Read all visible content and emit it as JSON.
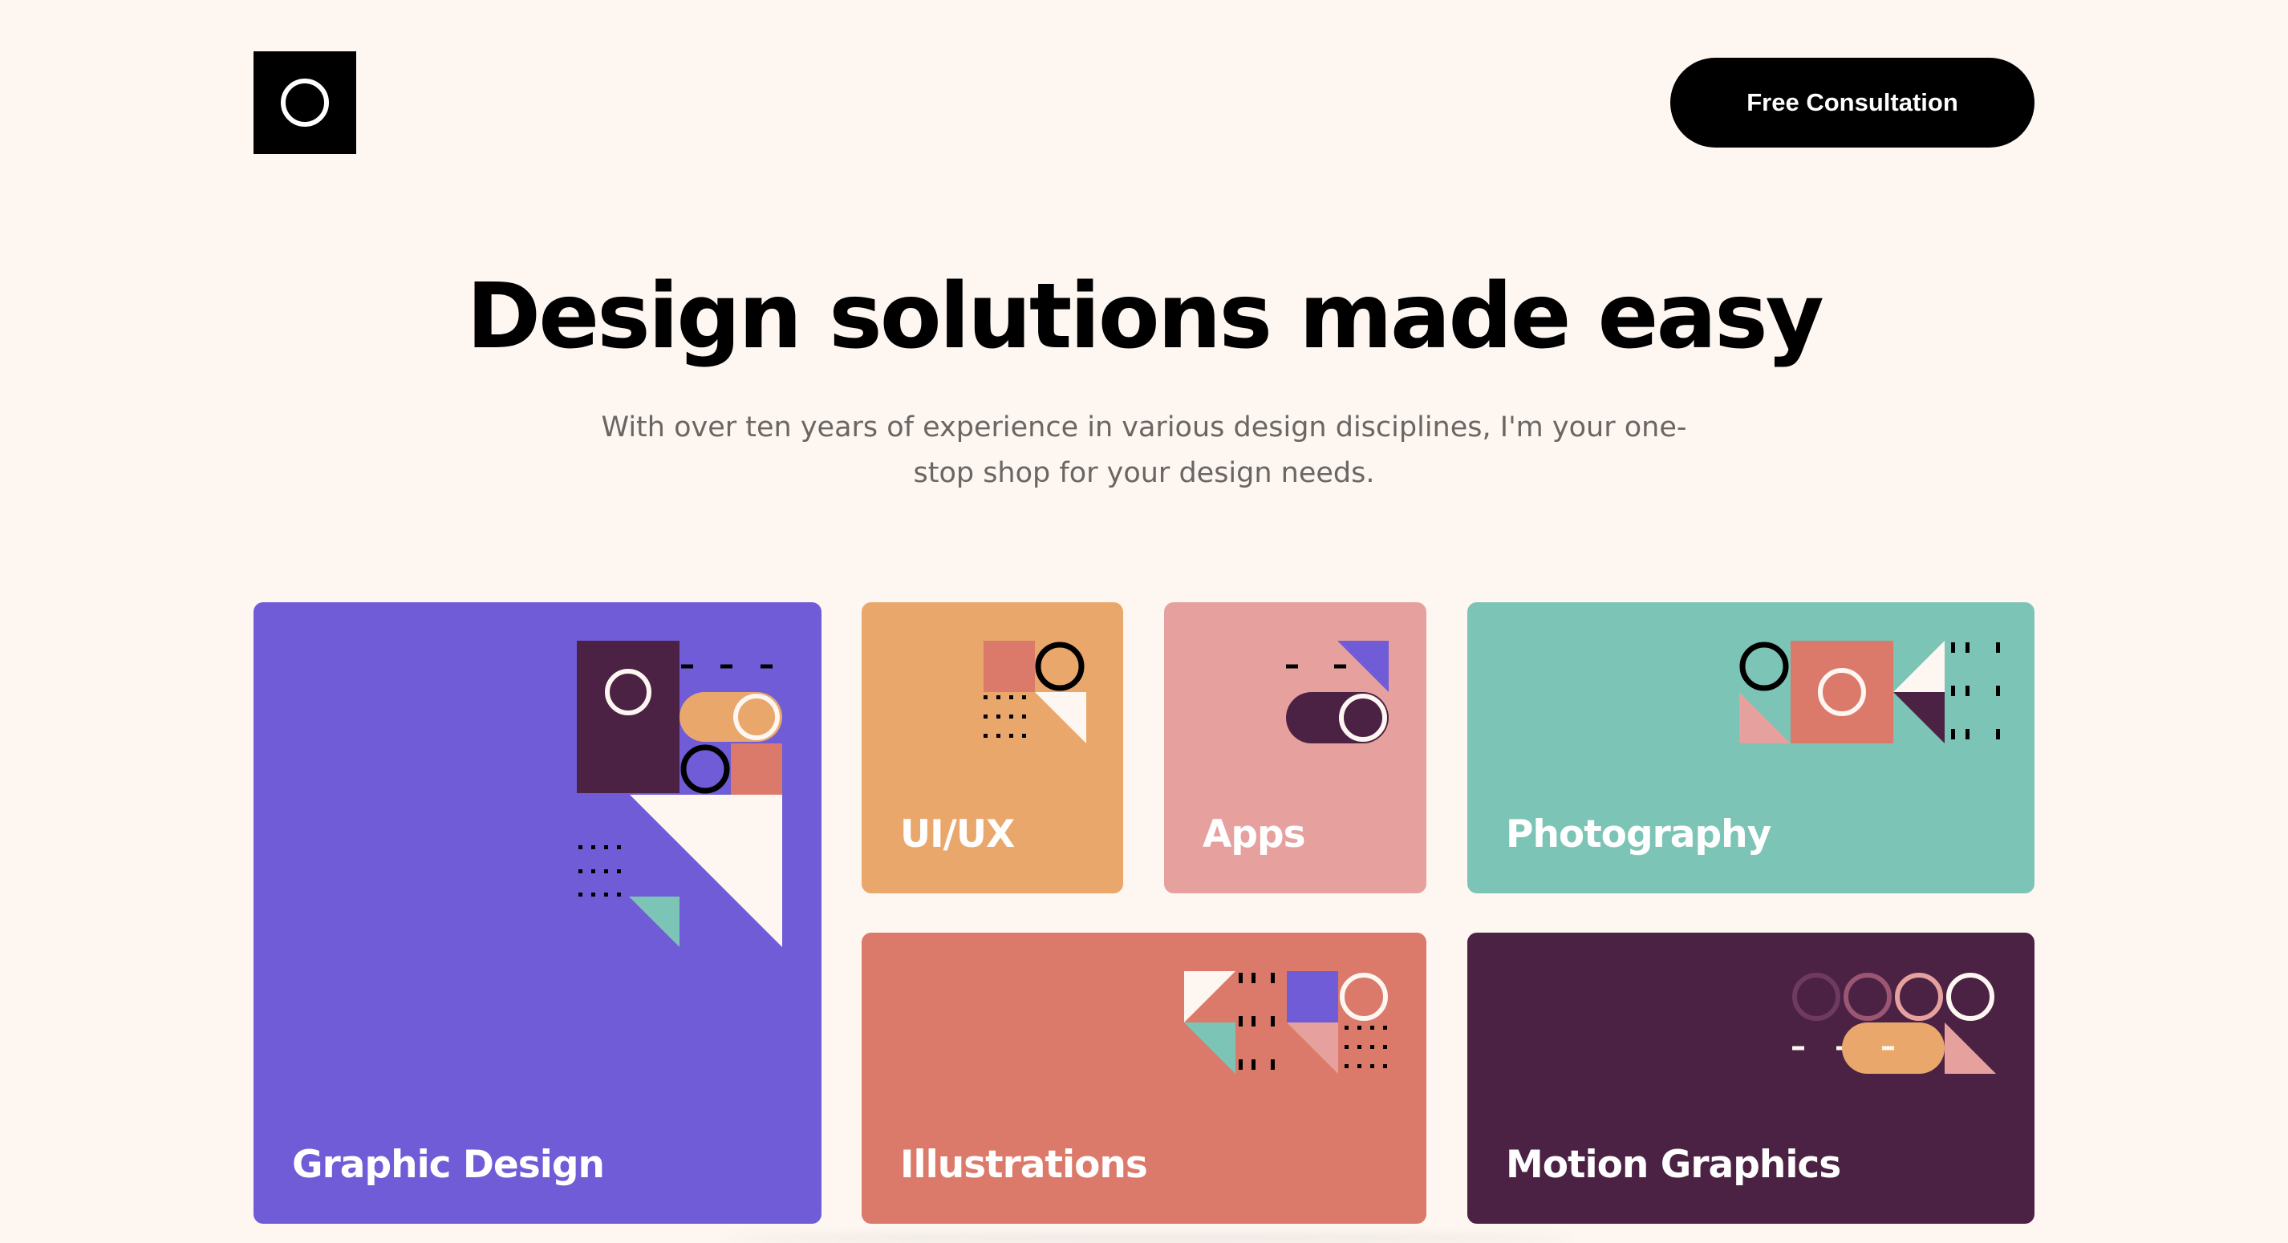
{
  "header": {
    "logo_icon": "circle-ring-logo",
    "cta_label": "Free Consultation"
  },
  "hero": {
    "title": "Design solutions made easy",
    "subtitle": "With over ten years of experience in various design disciplines, I'm your one-stop shop for your design needs."
  },
  "services": [
    {
      "label": "Graphic Design",
      "color": "#6F5CD6"
    },
    {
      "label": "UI/UX",
      "color": "#E9A76B"
    },
    {
      "label": "Apps",
      "color": "#E6A19E"
    },
    {
      "label": "Photography",
      "color": "#7CC4B6"
    },
    {
      "label": "Illustrations",
      "color": "#DB7A6A"
    },
    {
      "label": "Motion Graphics",
      "color": "#4B2244"
    }
  ],
  "palette": {
    "background": "#FDF6F1",
    "plum": "#4B2244",
    "cream": "#FDF6F1",
    "coral": "#DB7A6A",
    "mint": "#7CC4B6",
    "peach": "#E9A76B",
    "pink": "#E6A19E",
    "violet": "#6F5CD6"
  }
}
